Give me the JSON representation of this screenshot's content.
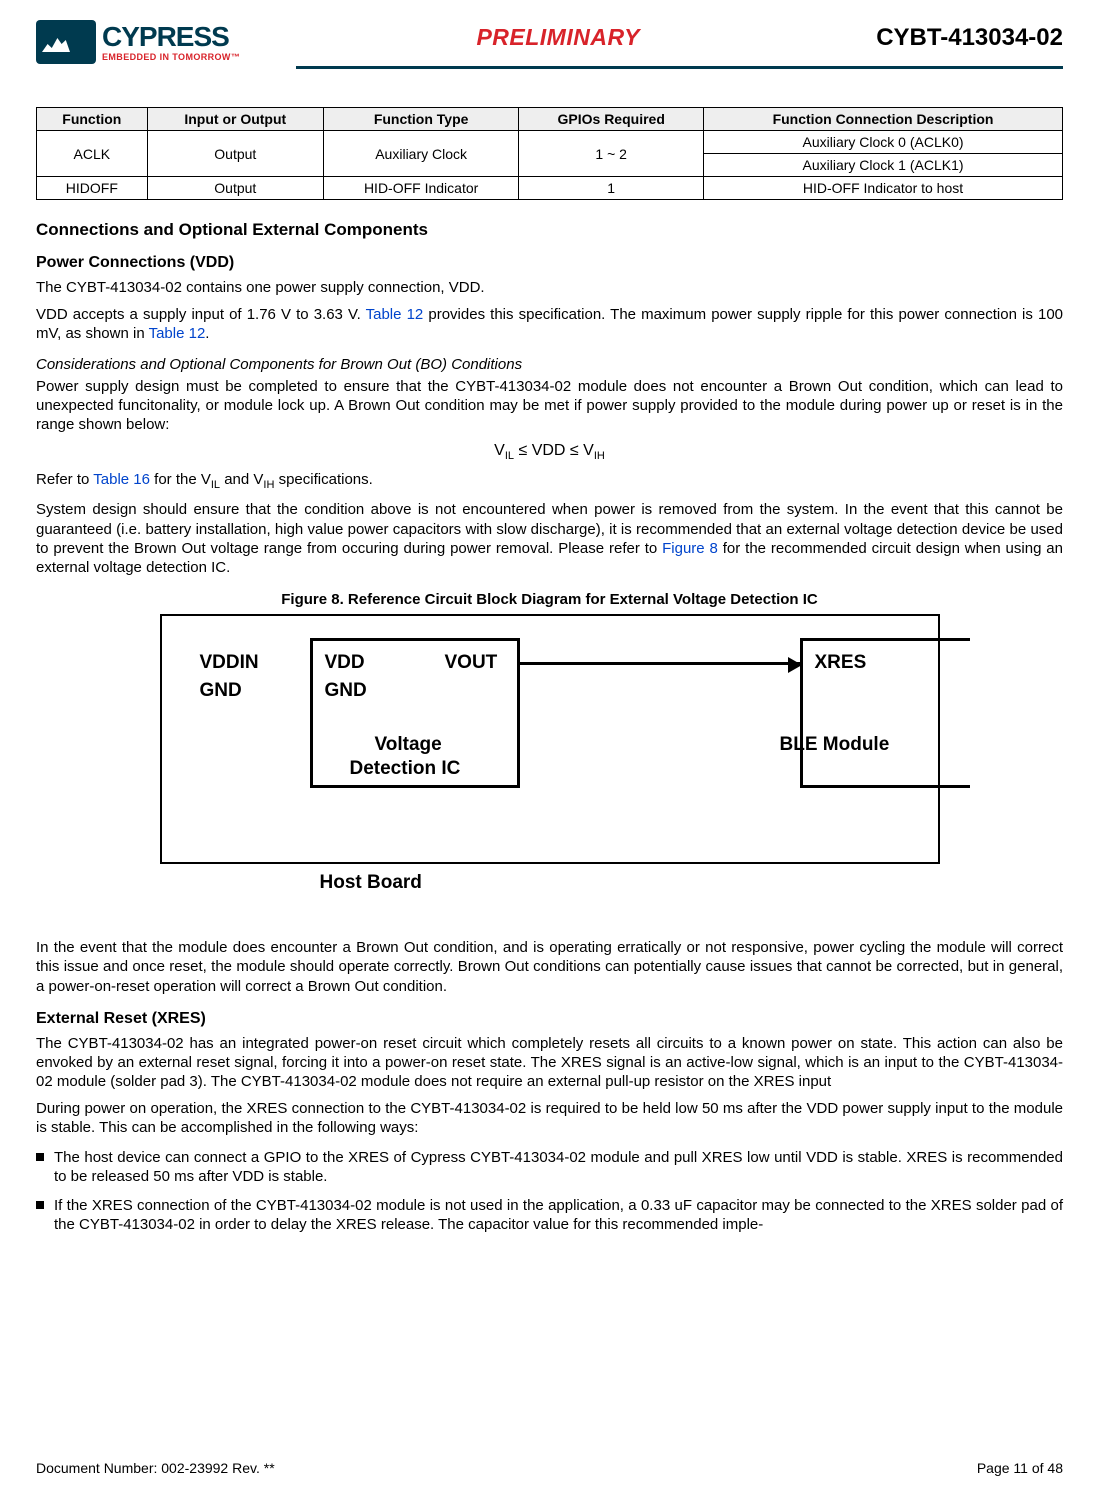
{
  "header": {
    "logo_main": "CYPRESS",
    "logo_tag": "EMBEDDED IN TOMORROW™",
    "preliminary": "PRELIMINARY",
    "partno": "CYBT-413034-02"
  },
  "table": {
    "headers": [
      "Function",
      "Input or Output",
      "Function Type",
      "GPIOs Required",
      "Function Connection Description"
    ],
    "rows": [
      {
        "function": "ACLK",
        "io": "Output",
        "ftype": "Auxiliary Clock",
        "gpios": "1 ~ 2",
        "desc": [
          "Auxiliary Clock 0 (ACLK0)",
          "Auxiliary Clock 1 (ACLK1)"
        ]
      },
      {
        "function": "HIDOFF",
        "io": "Output",
        "ftype": "HID-OFF Indicator",
        "gpios": "1",
        "desc": [
          "HID-OFF Indicator to host"
        ]
      }
    ]
  },
  "sections": {
    "conn_title": "Connections and Optional External Components",
    "vdd_title": "Power Connections (VDD)",
    "vdd_p1": "The CYBT-413034-02 contains one power supply connection, VDD.",
    "vdd_p2a": "VDD accepts a supply input of 1.76 V to 3.63 V. ",
    "vdd_p2_link1": "Table 12",
    "vdd_p2b": " provides this specification. The maximum power supply ripple for this power connection is 100 mV, as shown in ",
    "vdd_p2_link2": "Table 12",
    "vdd_p2c": ".",
    "bo_title": "Considerations and Optional Components for Brown Out (BO) Conditions",
    "bo_p1": "Power supply design must be completed to ensure that the CYBT-413034-02 module does not encounter a Brown Out condition, which can lead to unexpected funcitonality, or module lock up. A Brown Out condition may be met if power supply provided to the module during power up or reset is in the range shown below:",
    "ineq_lhs": "V",
    "ineq_sub1": "IL",
    "ineq_mid": " ≤ VDD ≤ V",
    "ineq_sub2": "IH",
    "bo_p2a": "Refer to ",
    "bo_p2_link": "Table 16",
    "bo_p2b": " for the V",
    "bo_p2_sub1": "IL",
    "bo_p2c": " and V",
    "bo_p2_sub2": "IH",
    "bo_p2d": " specifications.",
    "bo_p3a": "System design should ensure that the condition above is not encountered when power is removed from the system. In the event that this cannot be guaranteed (i.e. battery installation, high value power capacitors with slow discharge), it is recommended that an external voltage detection device be used to prevent the Brown Out voltage range from occuring during power removal. Please refer to ",
    "bo_p3_link": "Figure 8",
    "bo_p3b": " for the recommended circuit design when using an external voltage detection IC.",
    "fig_caption": "Figure 8.  Reference Circuit Block Diagram for External Voltage Detection IC",
    "fig": {
      "vddin": "VDDIN",
      "gnd_left": "GND",
      "vdd": "VDD",
      "vout": "VOUT",
      "gnd_right": "GND",
      "xres": "XRES",
      "vdic": "Voltage",
      "vdic2": "Detection IC",
      "ble": "BLE Module",
      "host": "Host Board"
    },
    "bo_p4": "In the event that the module does encounter a Brown Out condition, and is operating erratically or not responsive, power cycling the module will correct this issue and once reset, the module should operate correctly. Brown Out conditions can potentially cause issues that cannot be corrected, but in general, a power-on-reset operation will correct a Brown Out condition.",
    "xres_title": "External Reset (XRES)",
    "xres_p1": "The CYBT-413034-02 has an integrated power-on reset circuit which completely resets all circuits to a known power on state. This action can also be envoked by an external reset signal, forcing it into a power-on reset state. The XRES signal is an active-low signal, which is an input to the CYBT-413034-02 module (solder pad 3). The CYBT-413034-02 module does not require an external pull-up resistor on the XRES input",
    "xres_p2": "During power on operation, the XRES connection to the CYBT-413034-02 is required to be held low 50 ms after the VDD power supply input to the module is stable. This can be accomplished in the following ways:",
    "xres_bullets": [
      "The host device can connect a GPIO to the XRES of Cypress CYBT-413034-02 module and pull XRES low until VDD is stable. XRES is recommended to be released 50 ms after VDD is stable.",
      "If the XRES connection of the CYBT-413034-02 module is not used in the application, a 0.33 uF capacitor may be connected to the XRES solder pad of the CYBT-413034-02 in order to delay the XRES release. The capacitor value for this recommended imple-"
    ]
  },
  "footer": {
    "docnum": "Document Number: 002-23992 Rev. **",
    "page": "Page 11 of 48"
  }
}
